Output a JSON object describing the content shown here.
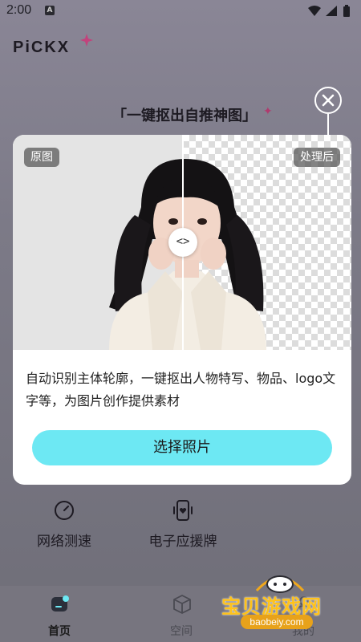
{
  "status_bar": {
    "time": "2:00",
    "app_indicator": "A",
    "icons": [
      "wifi-icon",
      "signal-icon",
      "battery-icon"
    ]
  },
  "brand": {
    "logo_text": "PiCKX"
  },
  "hero": {
    "title": "「一键抠出自推神图」"
  },
  "card": {
    "badge_original": "原图",
    "badge_processed": "处理后",
    "slider_glyph": "<>",
    "description": "自动识别主体轮廓，一键抠出人物特写、物品、logo文字等，为图片创作提供素材",
    "choose_button": "选择照片"
  },
  "tools": [
    {
      "label": "网络测速",
      "icon": "speedometer-icon"
    },
    {
      "label": "电子应援牌",
      "icon": "phone-heart-icon"
    }
  ],
  "bottom_nav": [
    {
      "label": "首页",
      "icon": "home-icon",
      "active": true
    },
    {
      "label": "空间",
      "icon": "cube-icon",
      "active": false
    },
    {
      "label": "我的",
      "icon": "profile-icon",
      "active": false
    }
  ],
  "watermark": {
    "name": "宝贝游戏网",
    "url": "baobeiy.com"
  },
  "colors": {
    "accent": "#6de8f3",
    "spark": "#b03a6e",
    "watermark": "#ffc21a"
  }
}
